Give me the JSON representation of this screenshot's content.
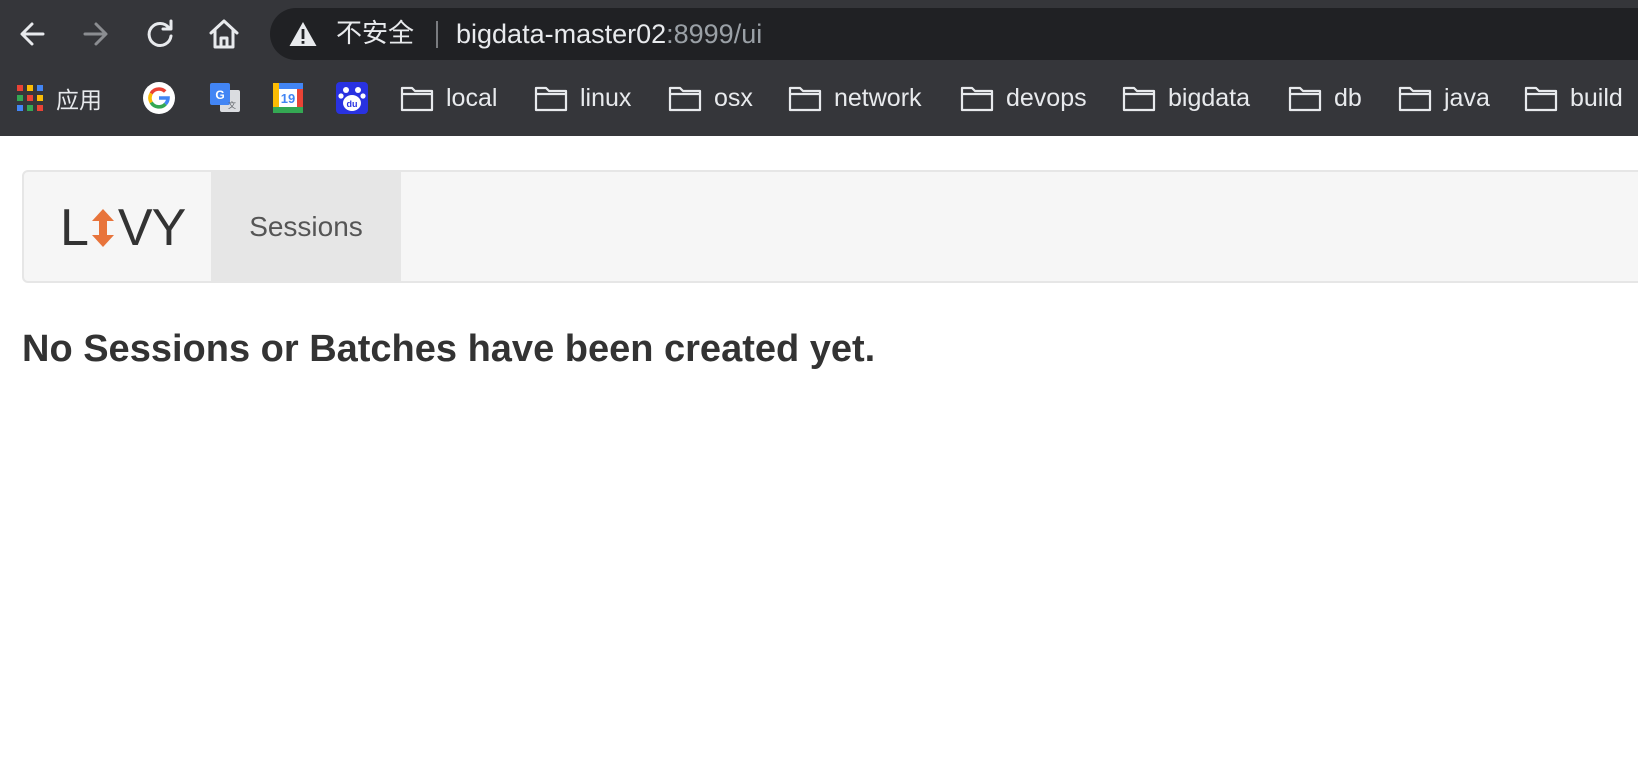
{
  "browser": {
    "nav_icons": [
      "arrow-left-icon",
      "arrow-right-icon",
      "reload-icon",
      "home-icon"
    ],
    "omnibox": {
      "security_icon": "warning-triangle-icon",
      "security_label": "不安全",
      "url_host": "bigdata-master02",
      "url_path": ":8999/ui"
    },
    "bookmarks": [
      {
        "label": "应用",
        "icon": "apps-grid-icon"
      },
      {
        "label": "",
        "icon": "google-icon"
      },
      {
        "label": "",
        "icon": "google-translate-icon"
      },
      {
        "label": "",
        "icon": "google-calendar-icon",
        "badge": "19"
      },
      {
        "label": "",
        "icon": "baidu-icon",
        "badge": "du"
      },
      {
        "label": "local",
        "icon": "folder-icon"
      },
      {
        "label": "linux",
        "icon": "folder-icon"
      },
      {
        "label": "osx",
        "icon": "folder-icon"
      },
      {
        "label": "network",
        "icon": "folder-icon"
      },
      {
        "label": "devops",
        "icon": "folder-icon"
      },
      {
        "label": "bigdata",
        "icon": "folder-icon"
      },
      {
        "label": "db",
        "icon": "folder-icon"
      },
      {
        "label": "java",
        "icon": "folder-icon"
      },
      {
        "label": "build",
        "icon": "folder-icon"
      }
    ],
    "colors": {
      "chrome_bg": "#35363a",
      "omnibox_bg": "#202124",
      "text": "#e8eaed",
      "muted_text": "#9aa0a6"
    }
  },
  "page": {
    "brand": {
      "pre": "L",
      "post": "VY",
      "accent_color": "#e8743b"
    },
    "nav": {
      "sessions_tab": "Sessions"
    },
    "message": "No Sessions or Batches have been created yet."
  }
}
